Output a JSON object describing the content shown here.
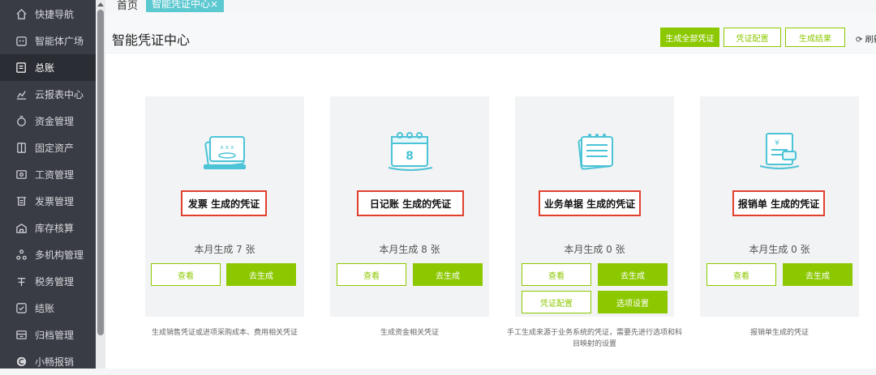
{
  "sidebar": {
    "items": [
      {
        "label": "快捷导航",
        "icon": "home-icon"
      },
      {
        "label": "智能体广场",
        "icon": "robot-icon"
      },
      {
        "label": "总账",
        "icon": "ledger-icon",
        "active": true
      },
      {
        "label": "云报表中心",
        "icon": "chart-icon"
      },
      {
        "label": "资金管理",
        "icon": "money-icon"
      },
      {
        "label": "固定资产",
        "icon": "asset-icon"
      },
      {
        "label": "工资管理",
        "icon": "salary-icon"
      },
      {
        "label": "发票管理",
        "icon": "invoice-icon"
      },
      {
        "label": "库存核算",
        "icon": "warehouse-icon"
      },
      {
        "label": "多机构管理",
        "icon": "org-icon"
      },
      {
        "label": "税务管理",
        "icon": "tax-icon"
      },
      {
        "label": "结账",
        "icon": "checkout-icon"
      },
      {
        "label": "归档管理",
        "icon": "archive-icon"
      },
      {
        "label": "小畅报销",
        "icon": "reimburse-icon"
      }
    ]
  },
  "tabs": {
    "home": "首页",
    "active": "智能凭证中心",
    "close": "×"
  },
  "header": {
    "title": "智能凭证中心",
    "generate_all": "生成全部凭证",
    "voucher_config": "凭证配置",
    "generate_result": "生成结果",
    "refresh": "刷新"
  },
  "cards": [
    {
      "label": "发票 生成的凭证",
      "count": "本月生成 7 张",
      "view": "查看",
      "generate": "去生成",
      "desc": "生成销售凭证或进项采购成本、费用相关凭证"
    },
    {
      "label": "日记账 生成的凭证",
      "count": "本月生成 8 张",
      "view": "查看",
      "generate": "去生成",
      "desc": "生成资金相关凭证"
    },
    {
      "label": "业务单据 生成的凭证",
      "count": "本月生成 0 张",
      "view": "查看",
      "generate": "去生成",
      "config": "凭证配置",
      "option": "选项设置",
      "desc": "手工生成来源于业务系统的凭证，需要先进行选项和科目映射的设置"
    },
    {
      "label": "报销单 生成的凭证",
      "count": "本月生成 0 张",
      "view": "查看",
      "generate": "去生成",
      "desc": "报销单生成的凭证"
    }
  ],
  "colors": {
    "accent": "#8cc800",
    "tab": "#5cc8d0",
    "highlight": "#e2402f",
    "icon": "#4cc3d6"
  }
}
